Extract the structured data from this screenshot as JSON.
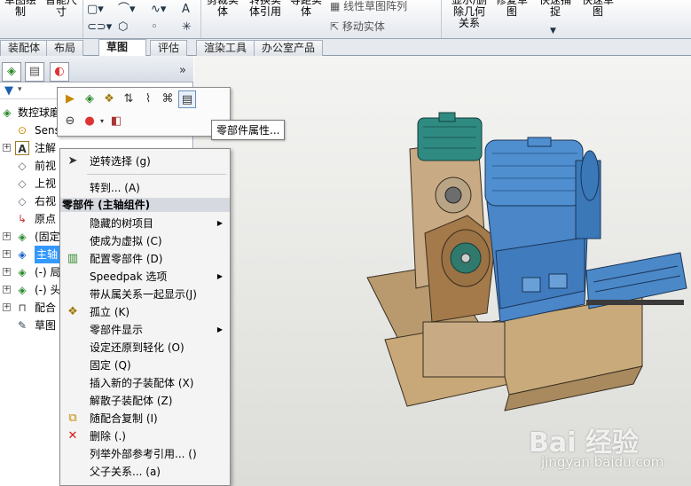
{
  "ribbon": {
    "items": [
      "草图绘制",
      "智能尺寸",
      "剪裁实体",
      "转换实体引用",
      "等距实体",
      "线性草图阵列",
      "移动实体",
      "显示/删除几何关系",
      "修复草图",
      "快速捕捉",
      "快速草图"
    ]
  },
  "tabs": [
    {
      "label": "装配体",
      "active": false
    },
    {
      "label": "布局",
      "active": false
    },
    {
      "label": "草图",
      "active": true
    },
    {
      "label": "评估",
      "active": false
    },
    {
      "label": "渲染工具",
      "active": false
    },
    {
      "label": "办公室产品",
      "active": false
    }
  ],
  "feature_tree": {
    "items": [
      {
        "label": "数控球磨",
        "icon": "assembly-icon"
      },
      {
        "label": "Sens",
        "icon": "sensor-icon"
      },
      {
        "label": "注解",
        "icon": "annotation-icon"
      },
      {
        "label": "前视",
        "icon": "plane-icon"
      },
      {
        "label": "上视",
        "icon": "plane-icon"
      },
      {
        "label": "右视",
        "icon": "plane-icon"
      },
      {
        "label": "原点",
        "icon": "origin-icon"
      },
      {
        "label": "(固定",
        "icon": "component-icon"
      },
      {
        "label": "主轴",
        "icon": "component-icon",
        "selected": true
      },
      {
        "label": "(-) 局",
        "icon": "component-icon"
      },
      {
        "label": "(-) 头",
        "icon": "component-icon"
      },
      {
        "label": "配合",
        "icon": "mate-icon"
      },
      {
        "label": "草图",
        "icon": "sketch-icon"
      }
    ]
  },
  "tooltip": "零部件属性...",
  "context_menu": {
    "header": "零部件 (主轴组件)",
    "items": [
      {
        "label": "逆转选择 (g)",
        "icon": "cursor-icon",
        "submenu": false
      },
      {
        "label": "转到... (A)",
        "icon": "",
        "submenu": false
      },
      {
        "label": "隐藏的树项目",
        "icon": "",
        "submenu": true
      },
      {
        "label": "使成为虚拟 (C)",
        "icon": "",
        "submenu": false
      },
      {
        "label": "配置零部件 (D)",
        "icon": "configure-icon",
        "submenu": false
      },
      {
        "label": "Speedpak 选项",
        "icon": "",
        "submenu": true
      },
      {
        "label": "带从属关系一起显示(J)",
        "icon": "",
        "submenu": false
      },
      {
        "label": "孤立 (K)",
        "icon": "isolate-icon",
        "submenu": false
      },
      {
        "label": "零部件显示",
        "icon": "",
        "submenu": true
      },
      {
        "label": "设定还原到轻化 (O)",
        "icon": "",
        "submenu": false
      },
      {
        "label": "固定 (Q)",
        "icon": "",
        "submenu": false
      },
      {
        "label": "插入新的子装配体 (X)",
        "icon": "",
        "submenu": false
      },
      {
        "label": "解散子装配体 (Z)",
        "icon": "",
        "submenu": false
      },
      {
        "label": "随配合复制 (I)",
        "icon": "copy-with-mates-icon",
        "submenu": false
      },
      {
        "label": "删除 (.)",
        "icon": "delete-icon",
        "submenu": false
      },
      {
        "label": "列举外部参考引用... ()",
        "icon": "",
        "submenu": false
      },
      {
        "label": "父子关系... (a)",
        "icon": "",
        "submenu": false
      }
    ]
  },
  "watermark": {
    "logo": "Bai 经验",
    "url": "jingyan.baidu.com"
  },
  "colors": {
    "selection": "#3399ff",
    "motor_blue": "#4a86c8",
    "base_tan": "#c9a878"
  }
}
